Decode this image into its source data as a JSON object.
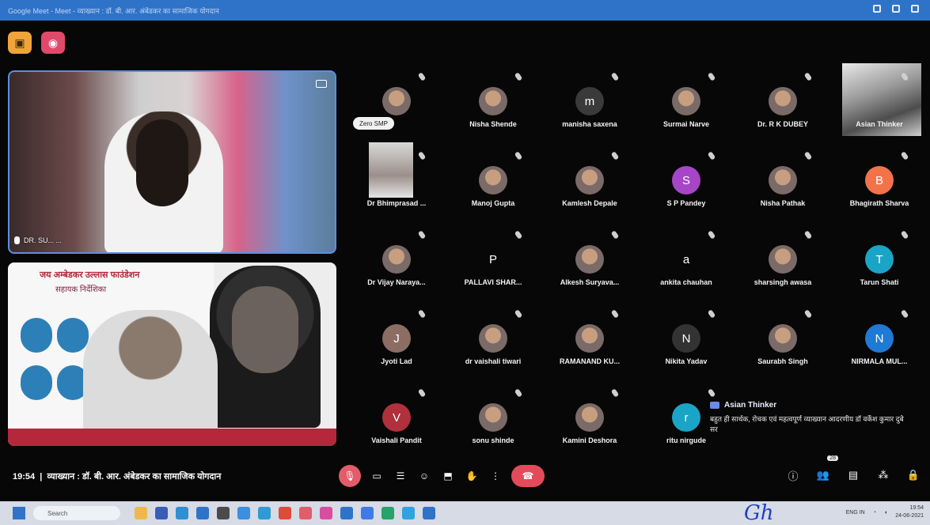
{
  "window": {
    "title": "Google Meet - Meet - व्याख्यान : डॉ. बी. आर. अंबेडकर का सामाजिक योगदान"
  },
  "top_buttons": [
    {
      "icon": "screen-share-icon"
    },
    {
      "icon": "record-icon"
    }
  ],
  "main_tiles": {
    "speaker_name": "DR. SU... ...",
    "presenter_title": "जय अम्बेडकर उल्लास फाउंडेशन",
    "presenter_subtitle": "सहायक निर्देशिका"
  },
  "participants": [
    {
      "name": "",
      "chip": "Zero SMP",
      "avatar": "photo"
    },
    {
      "name": "Nisha Shende",
      "avatar": "photo"
    },
    {
      "name": "manisha saxena",
      "avatar": "m",
      "color": "#3a3a3a"
    },
    {
      "name": "Surmai Narve",
      "avatar": "photo"
    },
    {
      "name": "Dr. R K DUBEY",
      "avatar": "photo"
    },
    {
      "name": "Asian Thinker",
      "avatar": "bigphoto"
    },
    {
      "name": "Dr Bhimprasad ...",
      "avatar": "tallphoto"
    },
    {
      "name": "Manoj Gupta",
      "avatar": "photo"
    },
    {
      "name": "Kamlesh Depale",
      "avatar": "photo"
    },
    {
      "name": "S P Pandey",
      "avatar": "S",
      "color": "#a646c7"
    },
    {
      "name": "Nisha Pathak",
      "avatar": "photo"
    },
    {
      "name": "Bhagirath Sharva",
      "avatar": "B",
      "color": "#f2734a"
    },
    {
      "name": "Dr Vijay Narayа...",
      "avatar": "photo"
    },
    {
      "name": "PALLAVI SHAR...",
      "avatar": "P",
      "color": "transparent"
    },
    {
      "name": "Alkesh Suryava...",
      "avatar": "photo"
    },
    {
      "name": "ankita chauhan",
      "avatar": "a",
      "color": "transparent"
    },
    {
      "name": "sharsingh awasa",
      "avatar": "photo"
    },
    {
      "name": "Tarun Shati",
      "avatar": "T",
      "color": "#1aa5c7"
    },
    {
      "name": "Jyoti Lad",
      "avatar": "J",
      "color": "#8b6d63"
    },
    {
      "name": "dr vaishali tiwari",
      "avatar": "photo"
    },
    {
      "name": "RAMANAND KU...",
      "avatar": "photo"
    },
    {
      "name": "Nikita Yadav",
      "avatar": "N",
      "color": "#333333"
    },
    {
      "name": "Saurabh Singh",
      "avatar": "photo"
    },
    {
      "name": "NIRMALA MUL...",
      "avatar": "N",
      "color": "#1f7ad6"
    },
    {
      "name": "Vaishali Pandit",
      "avatar": "V",
      "color": "#b0303c"
    },
    {
      "name": "sonu shinde",
      "avatar": "photo"
    },
    {
      "name": "Kamini Deshora",
      "avatar": "photo"
    },
    {
      "name": "ritu nirgude",
      "avatar": "r",
      "color": "#1aa5c7"
    }
  ],
  "chat": {
    "sender": "Asian Thinker",
    "message": "बहुत ही सार्थक, रोचक एवं महत्वपूर्ण व्याख्यान आदरणीय डॉ वर्केश कुमार दुबे सर"
  },
  "controls": {
    "time": "19:54",
    "meeting_title": "व्याख्यान : डॉ. बी. आर. अंबेडकर का सामाजिक योगदान",
    "center_icons": [
      "mic-off-icon",
      "camera-icon",
      "captions-icon",
      "emoji-icon",
      "present-icon",
      "raise-hand-icon",
      "more-icon",
      "end-call-icon"
    ],
    "right_icons": [
      "info-icon",
      "people-icon",
      "chat-icon",
      "activities-icon",
      "lock-icon"
    ],
    "people_badge": "28"
  },
  "taskbar": {
    "search": "Search",
    "lang": "ENG IN",
    "clock_time": "19:54",
    "clock_date": "24-06-2021"
  }
}
